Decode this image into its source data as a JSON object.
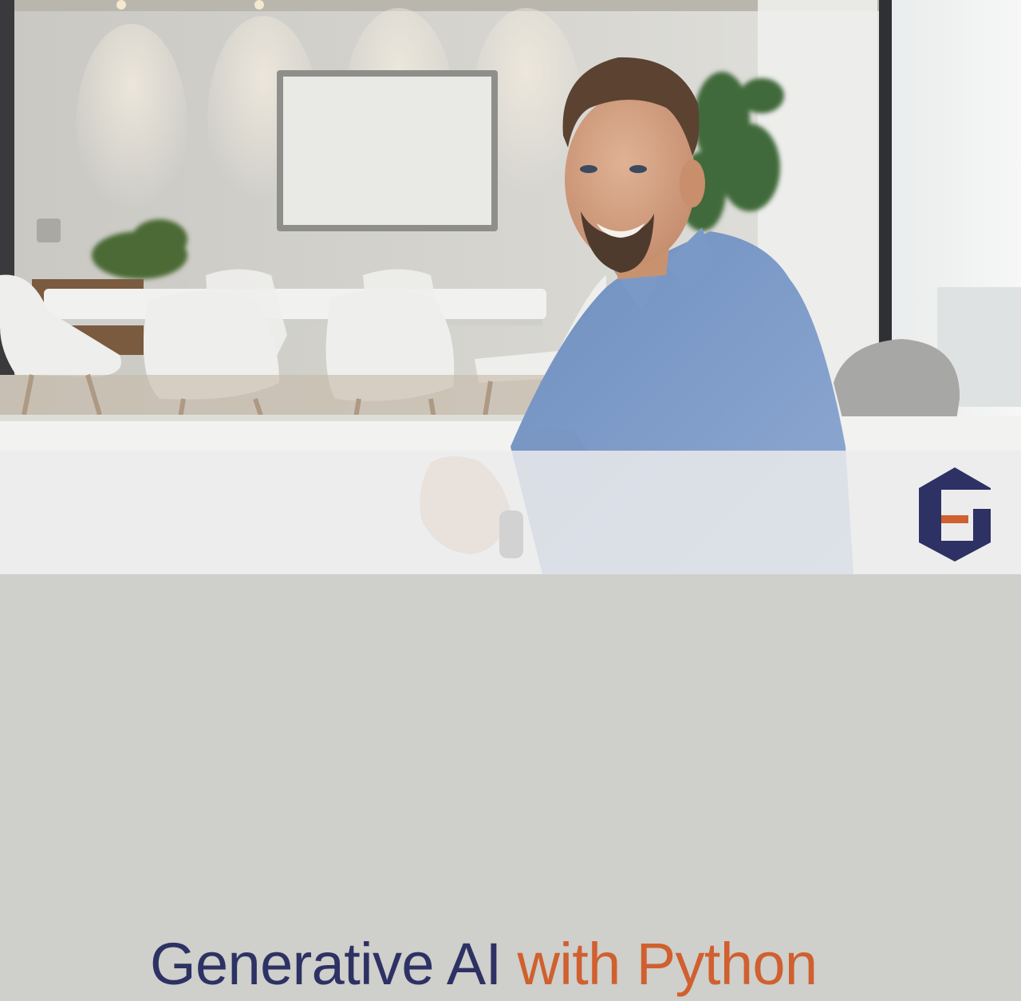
{
  "banner": {
    "title_part1": "Generative AI ",
    "title_part2": "with Python"
  },
  "colors": {
    "primary": "#2d3163",
    "accent": "#d0602f"
  },
  "logo": {
    "icon": "g-logo-icon"
  }
}
